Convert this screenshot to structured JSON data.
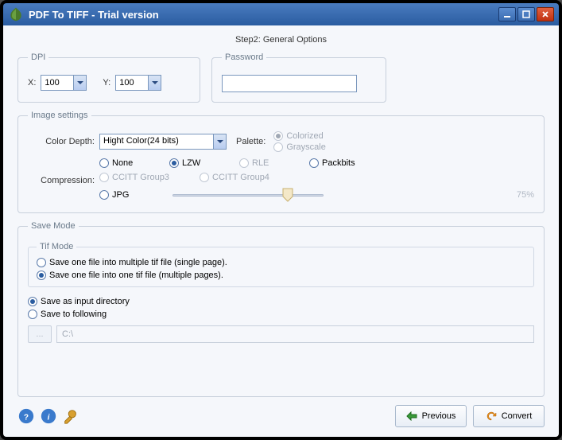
{
  "window": {
    "title": "PDF To TIFF - Trial version"
  },
  "step_label": "Step2: General Options",
  "dpi": {
    "legend": "DPI",
    "x_label": "X:",
    "x_value": "100",
    "y_label": "Y:",
    "y_value": "100"
  },
  "password": {
    "legend": "Password",
    "value": ""
  },
  "image_settings": {
    "legend": "Image settings",
    "color_depth_label": "Color Depth:",
    "color_depth_value": "Hight Color(24 bits)",
    "palette_label": "Palette:",
    "palette_colorized": "Colorized",
    "palette_grayscale": "Grayscale",
    "compression_label": "Compression:",
    "comp_none": "None",
    "comp_lzw": "LZW",
    "comp_rle": "RLE",
    "comp_packbits": "Packbits",
    "comp_ccitt3": "CCITT Group3",
    "comp_ccitt4": "CCITT Group4",
    "comp_jpg": "JPG",
    "jpg_quality": "75%"
  },
  "save_mode": {
    "legend": "Save Mode",
    "tif_legend": "Tif Mode",
    "opt_single": "Save one file into multiple tif file (single page).",
    "opt_multi": "Save one file into one tif file (multiple pages).",
    "as_input": "Save as input directory",
    "to_following": "Save to following",
    "browse": "...",
    "path": "C:\\"
  },
  "buttons": {
    "previous": "Previous",
    "convert": "Convert"
  }
}
